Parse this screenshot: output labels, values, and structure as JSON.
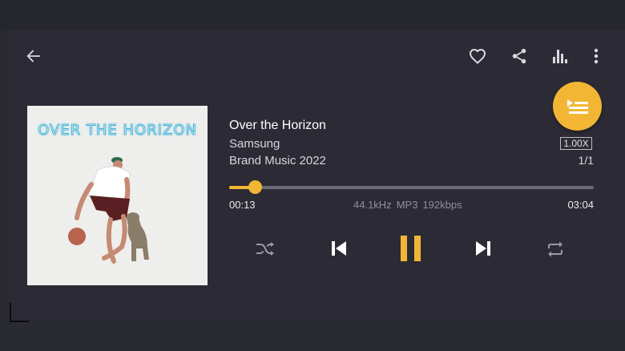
{
  "colors": {
    "background": "#2c2b35",
    "accent": "#f2b634",
    "icon": "#d9d9e0",
    "muted": "#8f8e9a"
  },
  "toolbar": {
    "back_icon": "arrow-left-icon",
    "favorite_icon": "heart-outline-icon",
    "share_icon": "share-icon",
    "equalizer_icon": "equalizer-bars-icon",
    "more_icon": "more-vertical-icon"
  },
  "album_art": {
    "title": "OVER THE HORIZON"
  },
  "track": {
    "title": "Over the Horizon",
    "artist": "Samsung",
    "album": "Brand Music 2022"
  },
  "queue": {
    "icon": "playlist-play-icon",
    "speed": "1.00X",
    "position": "1/1"
  },
  "progress": {
    "current": "00:13",
    "total": "03:04",
    "fraction": 0.07,
    "sample_rate": "44.1kHz",
    "format": "MP3",
    "bitrate": "192kbps"
  },
  "controls": {
    "shuffle_icon": "shuffle-icon",
    "previous_icon": "skip-previous-icon",
    "pause_icon": "pause-icon",
    "next_icon": "skip-next-icon",
    "repeat_icon": "repeat-icon"
  }
}
